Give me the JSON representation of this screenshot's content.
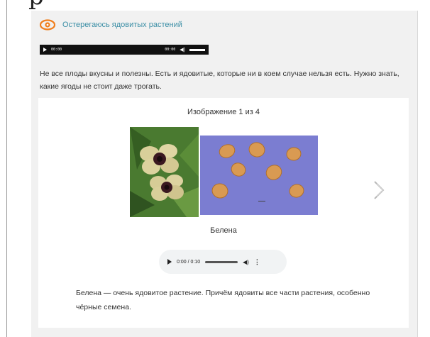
{
  "page_heading_fragment": "р",
  "header": {
    "title": "Остерегаюсь ядовитых растений",
    "icon": "eye-icon",
    "accent": "#f07e1c",
    "title_color": "#3c8fa6"
  },
  "top_audio": {
    "current_time": "00:00",
    "duration": "00:00"
  },
  "intro_text": "Не все плоды вкусны и полезны. Есть и ядовитые, которые ни в коем случае нельзя есть. Нужно знать, какие ягоды не стоит даже трогать.",
  "gallery": {
    "counter": "Изображение 1 из 4",
    "caption": "Белена",
    "images": [
      {
        "name": "henbane-flowers-photo"
      },
      {
        "name": "henbane-seeds-photo"
      }
    ],
    "next_icon": "chevron-right-icon"
  },
  "gallery_audio": {
    "time": "0:00 / 0:10"
  },
  "description": "Белена — очень ядовитое растение. Причём ядовиты все части растения, особенно чёрные семена."
}
